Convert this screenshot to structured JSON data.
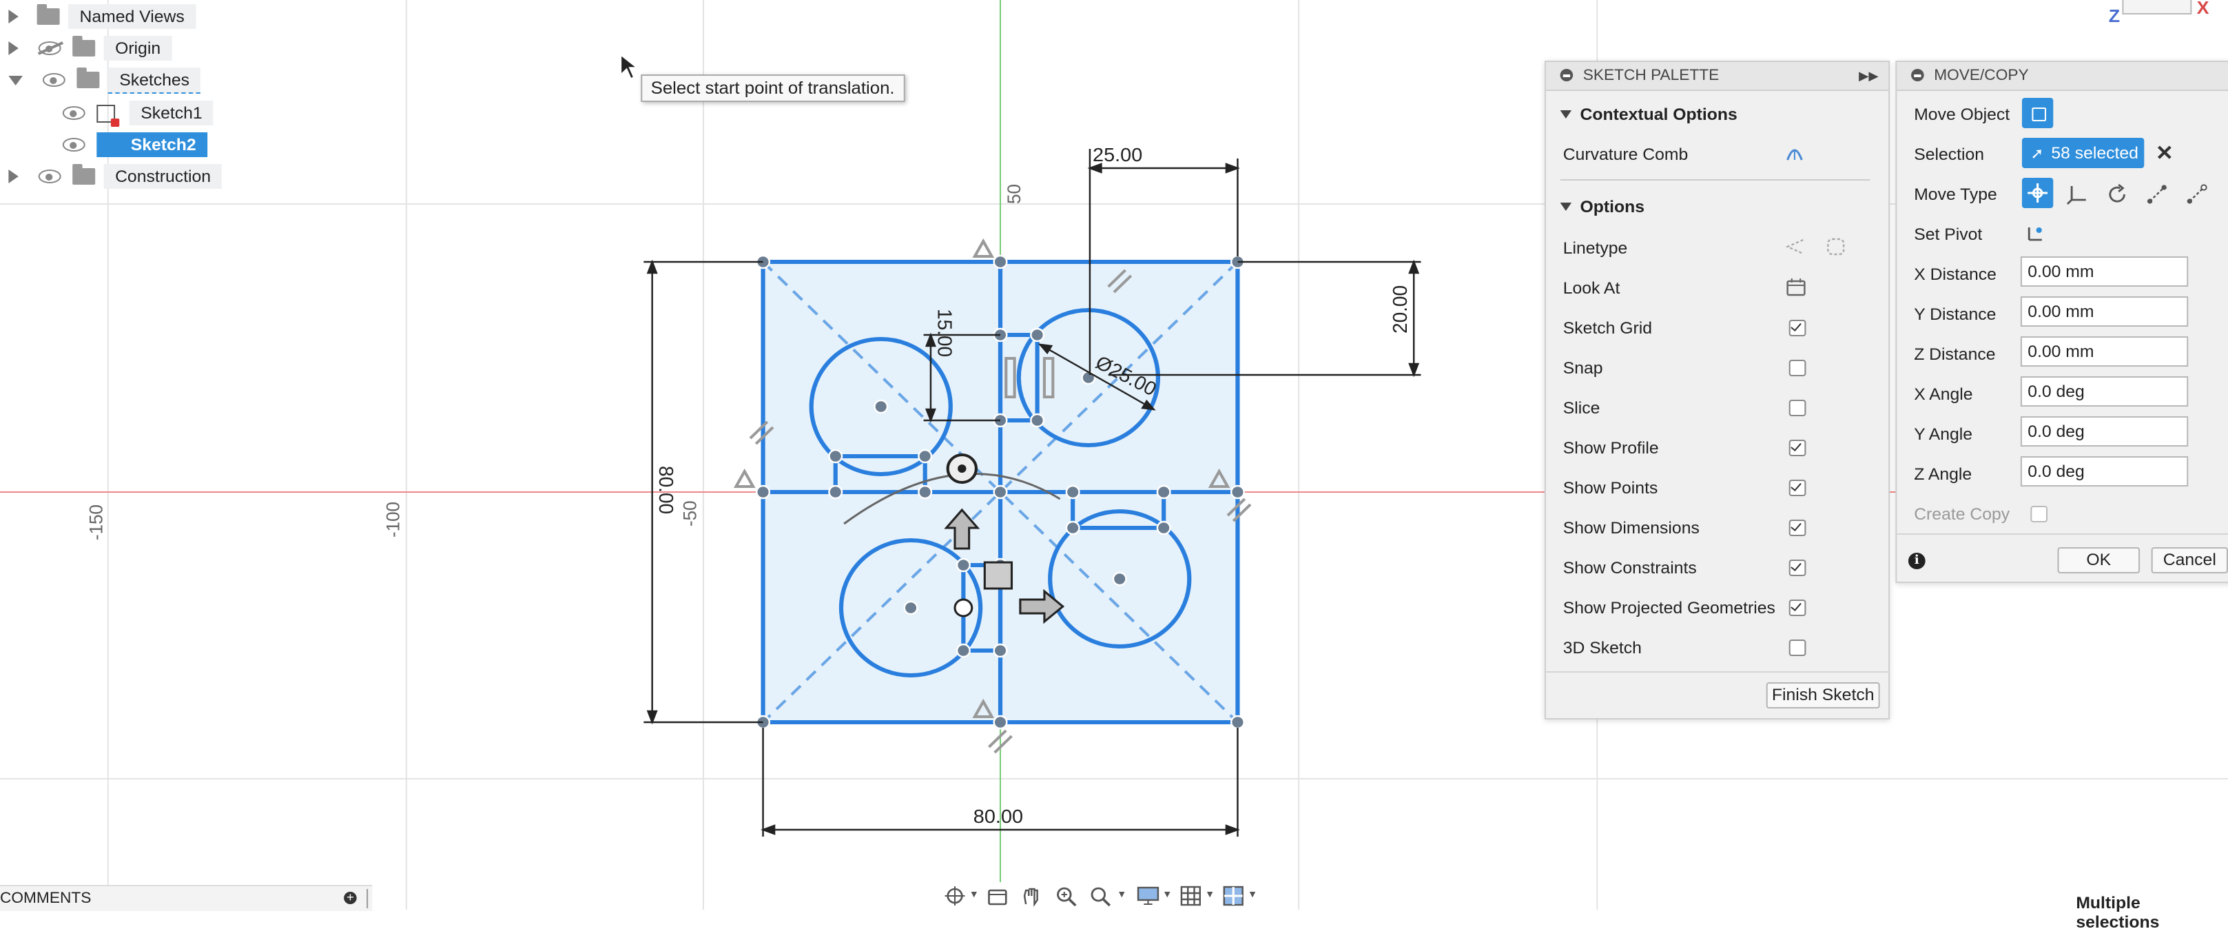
{
  "browser": {
    "items": [
      {
        "label": "Named Views"
      },
      {
        "label": "Origin"
      },
      {
        "label": "Sketches"
      },
      {
        "label": "Sketch1"
      },
      {
        "label": "Sketch2"
      },
      {
        "label": "Construction"
      }
    ]
  },
  "tooltip": "Select start point of translation.",
  "dimensions": {
    "d_25": "25.00",
    "d_20": "20.00",
    "d_15": "15.00",
    "d_dia": "Ø25.00",
    "d_80v": "80.00",
    "d_80h": "80.00"
  },
  "axis_labels": {
    "neg150": "-150",
    "neg100": "-100",
    "neg50": "-50",
    "pos50": "50"
  },
  "sketch_palette": {
    "title": "SKETCH PALETTE",
    "contextual_title": "Contextual Options",
    "curvature_comb": "Curvature Comb",
    "options_title": "Options",
    "rows": [
      {
        "label": "Linetype"
      },
      {
        "label": "Look At"
      },
      {
        "label": "Sketch Grid",
        "checked": true
      },
      {
        "label": "Snap",
        "checked": false
      },
      {
        "label": "Slice",
        "checked": false
      },
      {
        "label": "Show Profile",
        "checked": true
      },
      {
        "label": "Show Points",
        "checked": true
      },
      {
        "label": "Show Dimensions",
        "checked": true
      },
      {
        "label": "Show Constraints",
        "checked": true
      },
      {
        "label": "Show Projected Geometries",
        "checked": true
      },
      {
        "label": "3D Sketch",
        "checked": false
      }
    ],
    "finish_button": "Finish Sketch"
  },
  "move_copy": {
    "title": "MOVE/COPY",
    "move_object": "Move Object",
    "selection": "Selection",
    "selection_value": "58 selected",
    "move_type": "Move Type",
    "set_pivot": "Set Pivot",
    "fields": [
      {
        "label": "X Distance",
        "value": "0.00 mm"
      },
      {
        "label": "Y Distance",
        "value": "0.00 mm"
      },
      {
        "label": "Z Distance",
        "value": "0.00 mm"
      },
      {
        "label": "X Angle",
        "value": "0.0 deg"
      },
      {
        "label": "Y Angle",
        "value": "0.0 deg"
      },
      {
        "label": "Z Angle",
        "value": "0.0 deg"
      }
    ],
    "create_copy": "Create Copy",
    "ok": "OK",
    "cancel": "Cancel"
  },
  "comments": "COMMENTS",
  "status": "Multiple selections",
  "viewcube": {
    "z": "Z",
    "x": "X"
  },
  "colors": {
    "sketch_blue": "#2a7fde",
    "fill": "#e6f2fb",
    "select": "#2f8fdc"
  }
}
